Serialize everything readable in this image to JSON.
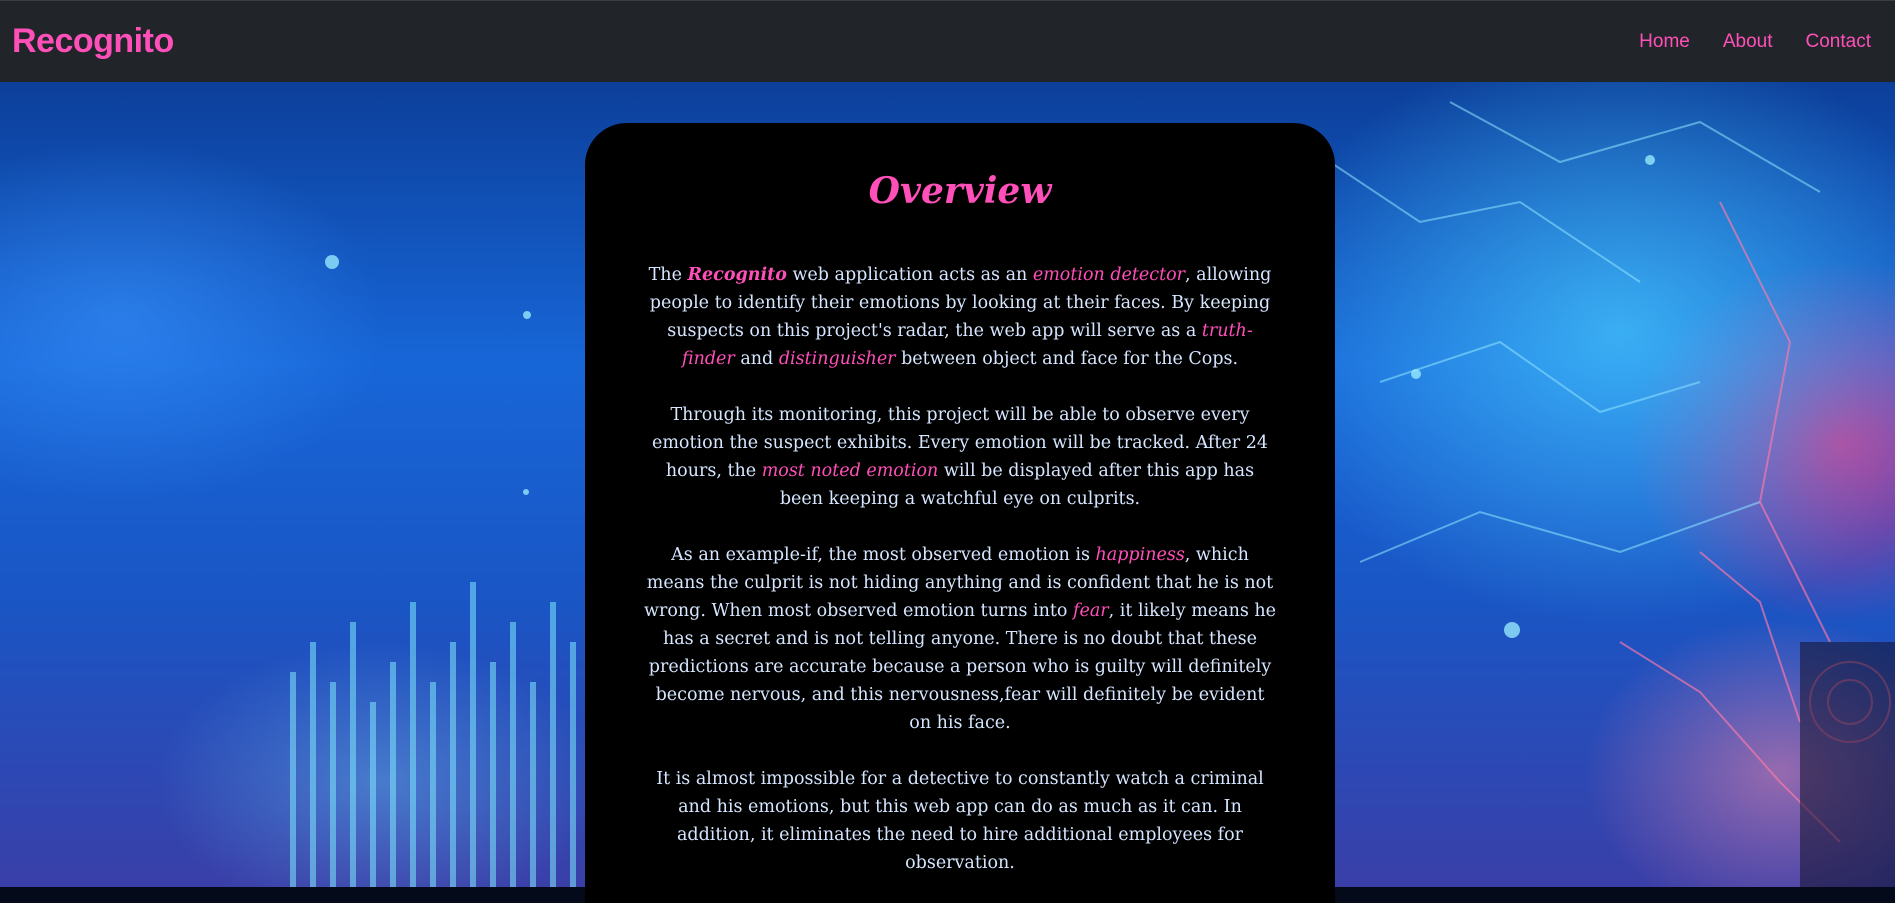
{
  "nav": {
    "brand": "Recognito",
    "links": [
      "Home",
      "About",
      "Contact"
    ]
  },
  "overview": {
    "title": "Overview",
    "p1": {
      "t1": "The ",
      "recognito": "Recognito",
      "t2": " web application acts as an ",
      "emotion_detector": "emotion detector",
      "t3": ", allowing people to identify their emotions by looking at their faces. By keeping suspects on this project's radar, the web app will serve as a ",
      "truth_finder": "truth-finder",
      "t4": " and ",
      "distinguisher": "distinguisher",
      "t5": " between object and face for the Cops."
    },
    "p2": {
      "t1": "Through its monitoring, this project will be able to observe every emotion the suspect exhibits. Every emotion will be tracked. After 24 hours, the ",
      "most_noted": "most noted emotion",
      "t2": " will be displayed after this app has been keeping a watchful eye on culprits."
    },
    "p3": {
      "t1": "As an example-if, the most observed emotion is ",
      "happiness": "happiness",
      "t2": ", which means the culprit is not hiding anything and is confident that he is not wrong. When most observed emotion turns into ",
      "fear": "fear",
      "t3": ", it likely means he has a secret and is not telling anyone. There is no doubt that these predictions are accurate because a person who is guilty will definitely become nervous, and this nervousness,fear will definitely be evident on his face."
    },
    "p4": "It is almost impossible for a detective to constantly watch a criminal and his emotions, but this web app can do as much as it can. In addition, it eliminates the need to hire additional employees for observation."
  },
  "colors": {
    "accent": "#ff4fb8",
    "navbar_bg": "#212529",
    "card_bg": "#000000",
    "body_text": "#d6e6ff"
  }
}
